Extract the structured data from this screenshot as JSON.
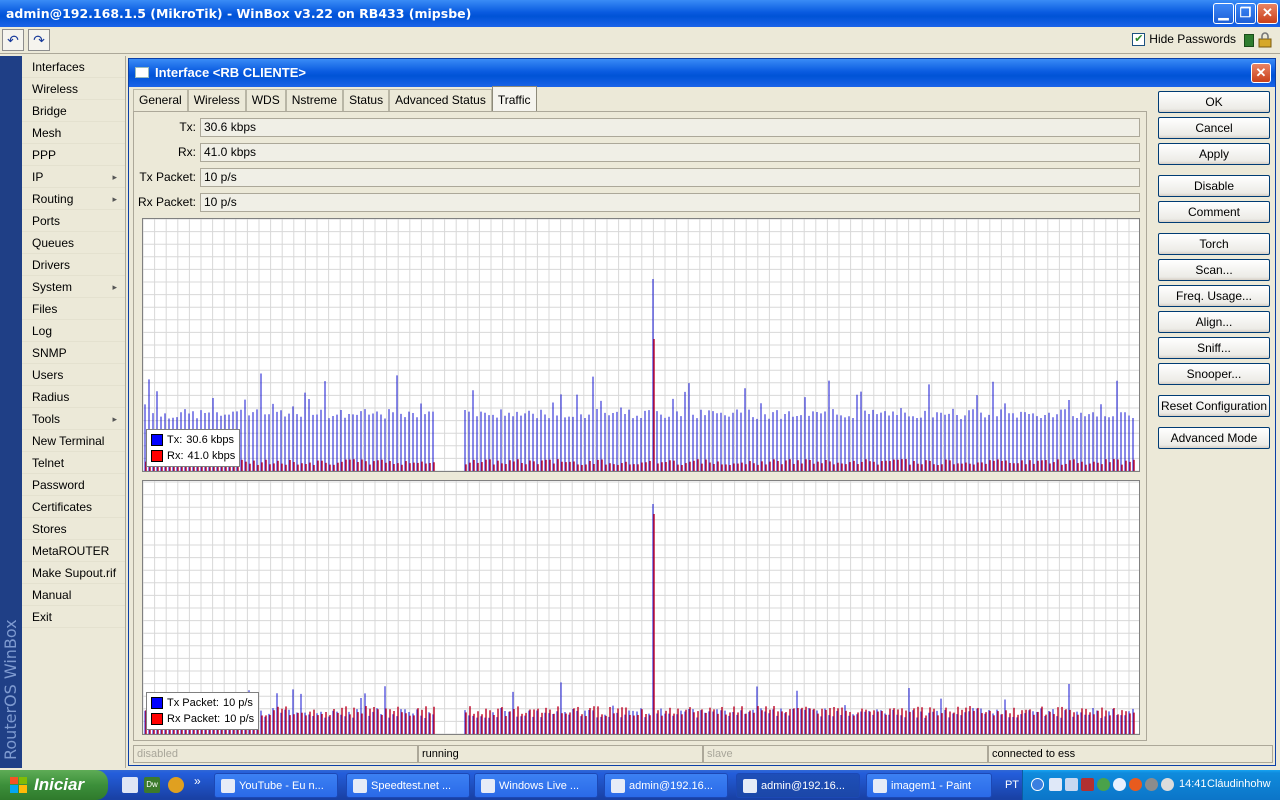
{
  "window": {
    "title": "admin@192.168.1.5 (MikroTik) - WinBox v3.22 on RB433 (mipsbe)"
  },
  "toolbar": {
    "undo_icon": "undo-icon",
    "redo_icon": "redo-icon",
    "hide_passwords_label": "Hide Passwords",
    "hide_passwords_checked": true
  },
  "brand": {
    "vertical_text": "RouterOS WinBox"
  },
  "menu": {
    "items": [
      {
        "label": "Interfaces",
        "submenu": false
      },
      {
        "label": "Wireless",
        "submenu": false
      },
      {
        "label": "Bridge",
        "submenu": false
      },
      {
        "label": "Mesh",
        "submenu": false
      },
      {
        "label": "PPP",
        "submenu": false
      },
      {
        "label": "IP",
        "submenu": true
      },
      {
        "label": "Routing",
        "submenu": true
      },
      {
        "label": "Ports",
        "submenu": false
      },
      {
        "label": "Queues",
        "submenu": false
      },
      {
        "label": "Drivers",
        "submenu": false
      },
      {
        "label": "System",
        "submenu": true
      },
      {
        "label": "Files",
        "submenu": false
      },
      {
        "label": "Log",
        "submenu": false
      },
      {
        "label": "SNMP",
        "submenu": false
      },
      {
        "label": "Users",
        "submenu": false
      },
      {
        "label": "Radius",
        "submenu": false
      },
      {
        "label": "Tools",
        "submenu": true
      },
      {
        "label": "New Terminal",
        "submenu": false
      },
      {
        "label": "Telnet",
        "submenu": false
      },
      {
        "label": "Password",
        "submenu": false
      },
      {
        "label": "Certificates",
        "submenu": false
      },
      {
        "label": "Stores",
        "submenu": false
      },
      {
        "label": "MetaROUTER",
        "submenu": false
      },
      {
        "label": "Make Supout.rif",
        "submenu": false
      },
      {
        "label": "Manual",
        "submenu": false
      },
      {
        "label": "Exit",
        "submenu": false
      }
    ],
    "submenu_arrow": "▸"
  },
  "interface_window": {
    "title": "Interface <RB CLIENTE>",
    "close_glyph": "✕",
    "tabs": [
      {
        "label": "General"
      },
      {
        "label": "Wireless"
      },
      {
        "label": "WDS"
      },
      {
        "label": "Nstreme"
      },
      {
        "label": "Status"
      },
      {
        "label": "Advanced Status"
      },
      {
        "label": "Traffic",
        "active": true
      }
    ],
    "fields": [
      {
        "label": "Tx:",
        "value": "30.6 kbps"
      },
      {
        "label": "Rx:",
        "value": "41.0 kbps"
      },
      {
        "label": "Tx Packet:",
        "value": "10 p/s"
      },
      {
        "label": "Rx Packet:",
        "value": "10 p/s"
      }
    ],
    "buttons": [
      {
        "label": "OK"
      },
      {
        "label": "Cancel"
      },
      {
        "label": "Apply"
      },
      {
        "label": "Disable"
      },
      {
        "label": "Comment"
      },
      {
        "label": "Torch"
      },
      {
        "label": "Scan..."
      },
      {
        "label": "Freq. Usage..."
      },
      {
        "label": "Align..."
      },
      {
        "label": "Sniff..."
      },
      {
        "label": "Snooper..."
      },
      {
        "label": "Reset Configuration"
      },
      {
        "label": "Advanced Mode"
      }
    ],
    "status": [
      {
        "text": "disabled",
        "dim": true
      },
      {
        "text": "running",
        "dim": false
      },
      {
        "text": "slave",
        "dim": true
      },
      {
        "text": "connected to ess",
        "dim": false
      }
    ]
  },
  "graphs": {
    "colors": {
      "tx": "#1010d0",
      "rx": "#c01030",
      "grid": "#d8d8d8"
    },
    "traffic_legend": [
      {
        "label": "Tx:",
        "value": "30.6 kbps",
        "color": "#0000ff"
      },
      {
        "label": "Rx:",
        "value": "41.0 kbps",
        "color": "#ff0000"
      }
    ],
    "packet_legend": [
      {
        "label": "Tx Packet:",
        "value": "10 p/s",
        "color": "#0000ff"
      },
      {
        "label": "Rx Packet:",
        "value": "10 p/s",
        "color": "#ff0000"
      }
    ]
  },
  "taskbar": {
    "start_label": "Iniciar",
    "tasks": [
      {
        "label": "YouTube - Eu n...",
        "active": false
      },
      {
        "label": "Speedtest.net ...",
        "active": false
      },
      {
        "label": "Windows Live ...",
        "active": false
      },
      {
        "label": "admin@192.16...",
        "active": false
      },
      {
        "label": "admin@192.16...",
        "active": true
      },
      {
        "label": "imagem1 - Paint",
        "active": false
      }
    ],
    "language": "PT",
    "clock": "14:41",
    "user": "Cláudinhohw",
    "quicklaunch_more": "»"
  }
}
